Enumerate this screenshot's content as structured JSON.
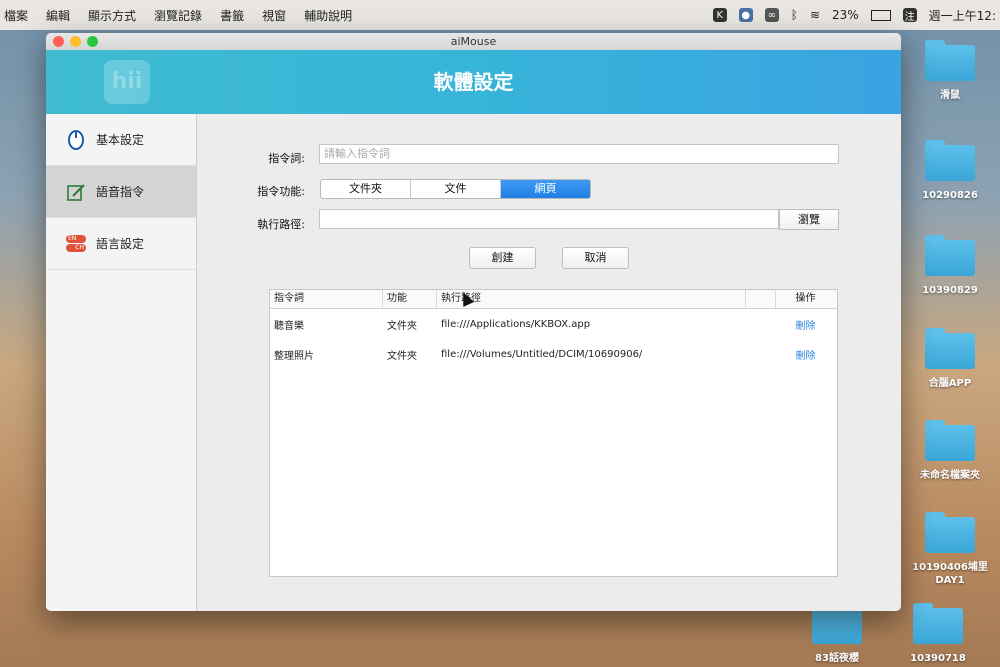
{
  "menubar": {
    "items": [
      "檔案",
      "編輯",
      "顯示方式",
      "瀏覽記錄",
      "書籤",
      "視窗",
      "輔助說明"
    ],
    "battery": "23%",
    "clock": "週一上午12:"
  },
  "desktop": {
    "icons": [
      "滑鼠",
      "10290826",
      "10390829",
      "合腦APP",
      "未命名檔案夾",
      "10190406埔里 DAY1",
      "83話夜櫻",
      "10390718"
    ]
  },
  "window": {
    "title": "aiMouse",
    "header_title": "軟體設定",
    "logo_text": "hii"
  },
  "sidebar": {
    "items": [
      {
        "label": "基本設定",
        "icon": "mouse-icon"
      },
      {
        "label": "語音指令",
        "icon": "edit-icon"
      },
      {
        "label": "語言設定",
        "icon": "language-toggle-icon",
        "en": "EN",
        "ch": "CH"
      }
    ]
  },
  "form": {
    "command_label": "指令詞:",
    "command_placeholder": "請輸入指令詞",
    "function_label": "指令功能:",
    "function_options": [
      "文件夾",
      "文件",
      "網頁"
    ],
    "function_selected": "網頁",
    "path_label": "執行路徑:",
    "browse_label": "瀏覽",
    "create_label": "創建",
    "cancel_label": "取消"
  },
  "table": {
    "headers": [
      "指令詞",
      "功能",
      "執行路徑",
      "",
      "操作"
    ],
    "rows": [
      {
        "command": "聽音樂",
        "function": "文件夾",
        "path": "file:///Applications/KKBOX.app",
        "action": "刪除"
      },
      {
        "command": "整理照片",
        "function": "文件夾",
        "path": "file:///Volumes/Untitled/DCIM/10690906/",
        "action": "刪除"
      }
    ]
  },
  "colors": {
    "header_start": "#3fbcd0",
    "header_end": "#3aa3e2",
    "segment_selected": "#1f7ee6",
    "action_link": "#2a82e4"
  }
}
